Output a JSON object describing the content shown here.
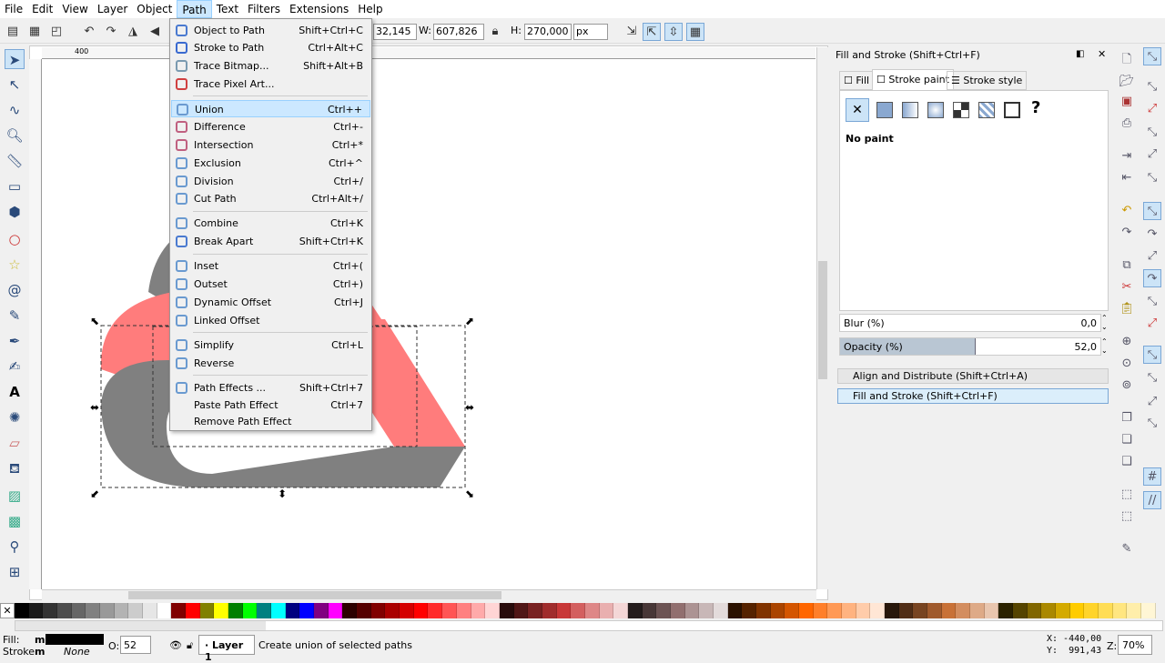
{
  "menubar": {
    "items": [
      "File",
      "Edit",
      "View",
      "Layer",
      "Object",
      "Path",
      "Text",
      "Filters",
      "Extensions",
      "Help"
    ],
    "active": "Path"
  },
  "toolbar": {
    "x_value": "32,145",
    "w_label": "W:",
    "w_value": "607,826",
    "h_label": "H:",
    "h_value": "270,000",
    "unit": "px"
  },
  "path_menu": {
    "items": [
      {
        "label": "Object to Path",
        "shortcut": "Shift+Ctrl+C",
        "icon": "object-to-path-icon",
        "color": "#4a7ad0"
      },
      {
        "label": "Stroke to Path",
        "shortcut": "Ctrl+Alt+C",
        "icon": "stroke-to-path-icon",
        "color": "#3a6ad0"
      },
      {
        "label": "Trace Bitmap...",
        "shortcut": "Shift+Alt+B",
        "icon": "trace-bitmap-icon",
        "color": "#7a9ab0"
      },
      {
        "label": "Trace Pixel Art...",
        "shortcut": "",
        "icon": "trace-pixel-art-icon",
        "color": "#d04040"
      },
      {
        "label": "Union",
        "shortcut": "Ctrl++",
        "icon": "union-icon",
        "color": "#6a9ad0"
      },
      {
        "label": "Difference",
        "shortcut": "Ctrl+-",
        "icon": "difference-icon",
        "color": "#c06080"
      },
      {
        "label": "Intersection",
        "shortcut": "Ctrl+*",
        "icon": "intersection-icon",
        "color": "#c06080"
      },
      {
        "label": "Exclusion",
        "shortcut": "Ctrl+^",
        "icon": "exclusion-icon",
        "color": "#6a9ad0"
      },
      {
        "label": "Division",
        "shortcut": "Ctrl+/",
        "icon": "division-icon",
        "color": "#6a9ad0"
      },
      {
        "label": "Cut Path",
        "shortcut": "Ctrl+Alt+/",
        "icon": "cut-path-icon",
        "color": "#6a9ad0"
      },
      {
        "label": "Combine",
        "shortcut": "Ctrl+K",
        "icon": "combine-icon",
        "color": "#6a9ad0"
      },
      {
        "label": "Break Apart",
        "shortcut": "Shift+Ctrl+K",
        "icon": "break-apart-icon",
        "color": "#4a7ad0"
      },
      {
        "label": "Inset",
        "shortcut": "Ctrl+(",
        "icon": "inset-icon",
        "color": "#6a9ad0"
      },
      {
        "label": "Outset",
        "shortcut": "Ctrl+)",
        "icon": "outset-icon",
        "color": "#6a9ad0"
      },
      {
        "label": "Dynamic Offset",
        "shortcut": "Ctrl+J",
        "icon": "dynamic-offset-icon",
        "color": "#6a9ad0"
      },
      {
        "label": "Linked Offset",
        "shortcut": "",
        "icon": "linked-offset-icon",
        "color": "#6a9ad0"
      },
      {
        "label": "Simplify",
        "shortcut": "Ctrl+L",
        "icon": "simplify-icon",
        "color": "#6a9ad0"
      },
      {
        "label": "Reverse",
        "shortcut": "",
        "icon": "reverse-icon",
        "color": "#6a9ad0"
      },
      {
        "label": "Path Effects ...",
        "shortcut": "Shift+Ctrl+7",
        "icon": "path-effects-icon",
        "color": "#6a9ad0"
      },
      {
        "label": "Paste Path Effect",
        "shortcut": "Ctrl+7",
        "icon": "",
        "color": ""
      },
      {
        "label": "Remove Path Effect",
        "shortcut": "",
        "icon": "",
        "color": ""
      }
    ]
  },
  "panel": {
    "title": "Fill and Stroke (Shift+Ctrl+F)",
    "tabs": [
      "Fill",
      "Stroke paint",
      "Stroke style"
    ],
    "active_tab": "Stroke paint",
    "paint_state": "No paint",
    "blur_label": "Blur (%)",
    "blur_value": "0,0",
    "opacity_label": "Opacity (%)",
    "opacity_value": "52,0",
    "opacity_fraction": 0.52,
    "docked": [
      "Align and Distribute (Shift+Ctrl+A)",
      "Fill and Stroke (Shift+Ctrl+F)"
    ]
  },
  "ruler": {
    "label": "400"
  },
  "status": {
    "fill_label": "Fill:",
    "fill_m": "m",
    "stroke_label": "Stroke:",
    "stroke_m": "m",
    "stroke_value": "None",
    "fill_color": "#000000",
    "o_label": "O:",
    "o_value": "52",
    "layer": "Layer 1",
    "message": "Create union of selected paths",
    "x_readout": "X: -440,00",
    "y_readout": "Y:  991,43",
    "z_label": "Z:",
    "zoom": "70%"
  },
  "canvas": {
    "gray": "#808080",
    "salmon": "#ff7c7c"
  },
  "palette": [
    "#000000",
    "#1a1a1a",
    "#333333",
    "#4d4d4d",
    "#666666",
    "#808080",
    "#999999",
    "#b3b3b3",
    "#cccccc",
    "#e6e6e6",
    "#ffffff",
    "#800000",
    "#ff0000",
    "#808000",
    "#ffff00",
    "#008000",
    "#00ff00",
    "#008080",
    "#00ffff",
    "#000080",
    "#0000ff",
    "#800080",
    "#ff00ff",
    "#2b0000",
    "#550000",
    "#800000",
    "#aa0000",
    "#d40000",
    "#ff0000",
    "#ff2a2a",
    "#ff5555",
    "#ff8080",
    "#ffaaaa",
    "#ffd5d5",
    "#280b0b",
    "#501616",
    "#782121",
    "#a02c2c",
    "#c83737",
    "#d35f5f",
    "#de8787",
    "#e9afaf",
    "#f4d7d7",
    "#241c1c",
    "#483737",
    "#6c5353",
    "#916f6f",
    "#ac9393",
    "#c8b7b7",
    "#e3dbdb",
    "#2b1100",
    "#552200",
    "#803300",
    "#aa4400",
    "#d45500",
    "#ff6600",
    "#ff7f2a",
    "#ff9955",
    "#ffb380",
    "#ffccaa",
    "#ffe6d5",
    "#28170b",
    "#502d16",
    "#784421",
    "#a05a2c",
    "#c87137",
    "#d38d5f",
    "#deaa87",
    "#e9c6af",
    "#2b2200",
    "#554400",
    "#806600",
    "#aa8800",
    "#d4aa00",
    "#ffcc00",
    "#ffd42a",
    "#ffdd55",
    "#ffe680",
    "#ffeeaa",
    "#fff6d5"
  ]
}
